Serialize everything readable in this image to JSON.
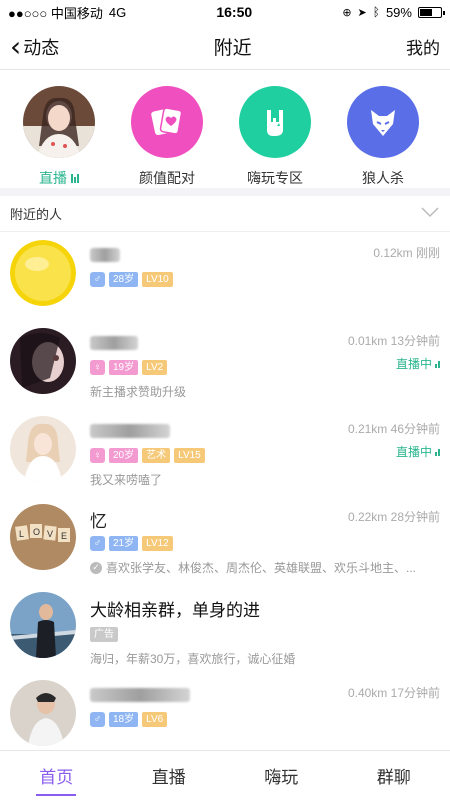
{
  "status": {
    "carrier": "●●○○○ 中国移动",
    "network": "4G",
    "time": "16:50",
    "battery": "59%",
    "battery_level": 0.59
  },
  "nav": {
    "back_label": "动态",
    "title": "附近",
    "right_label": "我的"
  },
  "features": [
    {
      "label": "直播",
      "icon": "live-avatar"
    },
    {
      "label": "颜值配对",
      "icon": "cards-heart-icon",
      "color": "#f04fbf"
    },
    {
      "label": "嗨玩专区",
      "icon": "rock-hand-icon",
      "color": "#1fcf9f"
    },
    {
      "label": "狼人杀",
      "icon": "wolf-icon",
      "color": "#5a6ee8"
    }
  ],
  "section": {
    "title": "附近的人"
  },
  "people": [
    {
      "age": "28岁",
      "level": "LV10",
      "gender": "male",
      "distance_time": "0.12km 刚刚"
    },
    {
      "age": "19岁",
      "level": "LV2",
      "gender": "female",
      "distance_time": "0.01km 13分钟前",
      "live": "直播中",
      "sub": "新主播求赞助升级"
    },
    {
      "age": "20岁",
      "art": "艺术",
      "level": "LV15",
      "gender": "female",
      "distance_time": "0.21km 46分钟前",
      "live": "直播中",
      "sub": "我又来唠嗑了"
    },
    {
      "name": "忆",
      "age": "21岁",
      "level": "LV12",
      "gender": "male",
      "distance_time": "0.22km 28分钟前",
      "sub": "喜欢张学友、林俊杰、周杰伦、英雄联盟、欢乐斗地主、..."
    },
    {
      "ad_title": "大龄相亲群，单身的进",
      "ad_tag": "广告",
      "sub": "海归，年薪30万，喜欢旅行，诚心征婚"
    },
    {
      "age": "18岁",
      "level": "LV6",
      "gender": "male",
      "distance_time": "0.40km 17分钟前"
    }
  ],
  "tabs": [
    {
      "label": "首页"
    },
    {
      "label": "直播"
    },
    {
      "label": "嗨玩"
    },
    {
      "label": "群聊"
    }
  ],
  "colors": {
    "accent": "#8b5cf0",
    "live_green": "#2bb58e"
  }
}
